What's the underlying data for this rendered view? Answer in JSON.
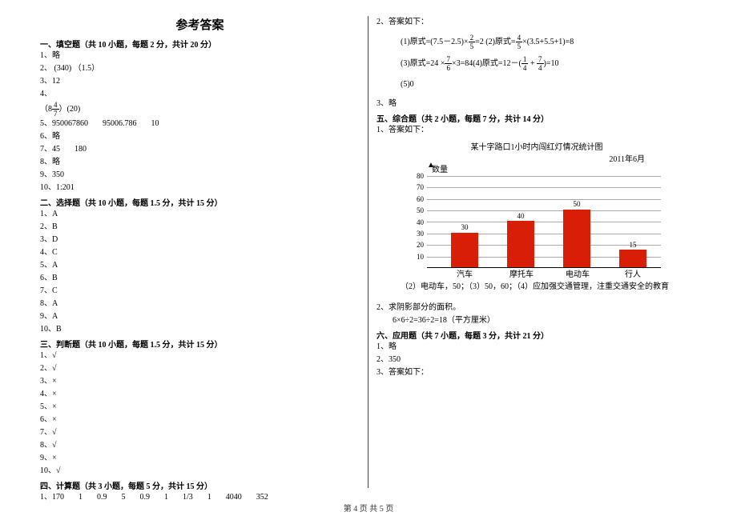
{
  "title": "参考答案",
  "footer": "第 4 页 共 5 页",
  "left": {
    "s1_h": "一、填空题（共 10 小题，每题 2 分，共计 20 分）",
    "s1": {
      "i1": "1、略",
      "i2": "2、 (340) （1.5）",
      "i3": "3、12",
      "i4": "4、",
      "i4_pre": "（8",
      "i4_num": "4",
      "i4_den": "7",
      "i4_post": "）(20)",
      "i5a": "5、950067860",
      "i5b": "95006.786",
      "i5c": "10",
      "i6": "6、略",
      "i7a": "7、45",
      "i7b": "180",
      "i8": "8、略",
      "i9": "9、350",
      "i10": "10、1:201"
    },
    "s2_h": "二、选择题（共 10 小题，每题 1.5 分，共计 15 分）",
    "s2": [
      "1、A",
      "2、B",
      "3、D",
      "4、C",
      "5、A",
      "6、B",
      "7、C",
      "8、A",
      "9、A",
      "10、B"
    ],
    "s3_h": "三、判断题（共 10 小题，每题 1.5 分，共计 15 分）",
    "s3": [
      "1、√",
      "2、√",
      "3、×",
      "4、×",
      "5、×",
      "6、×",
      "7、√",
      "8、√",
      "9、×",
      "10、√"
    ],
    "s4_h": "四、计算题（共 3 小题，每题 5 分，共计 15 分）",
    "s4_row": [
      "1、170",
      "1",
      "0.9",
      "5",
      "0.9",
      "1",
      "1/3",
      "1",
      "4040",
      "352"
    ]
  },
  "right": {
    "r2": "2、答案如下：",
    "eq1_pre": "(1)原式=(7.5－2.5)×",
    "eq1_num": "2",
    "eq1_den": "5",
    "eq1_post1": "=2",
    "eq1_sep": "   (2)原式=",
    "eq2_num": "4",
    "eq2_den": "5",
    "eq2_post": "×(3.5+5.5+1)=8",
    "eq3_pre": "(3)原式=24 ×",
    "eq3_num": "7",
    "eq3_den": "6",
    "eq3_post1": "×3=84",
    "eq4_pre": "(4)原式=12－(",
    "eq4a_num": "1",
    "eq4a_den": "4",
    "eq4_plus": " + ",
    "eq4b_num": "7",
    "eq4b_den": "4",
    "eq4_post": ")=10",
    "eq5": "(5)0",
    "r3": "3、略",
    "s5_h": "五、综合题（共 2 小题，每题 7 分，共计 14 分）",
    "r5_1": "1、答案如下：",
    "chart_title": "某十字路口1小时内闯红灯情况统计图",
    "chart_date": "2011年6月",
    "chart_ylabel": "数量",
    "chart_note1": "（2）电动车，50；（3）50，60；（4）应加强交通管理，注重交通安全的教育",
    "r5_2a": "2、求阴影部分的面积。",
    "r5_2b": "6×6÷2=36÷2=18（平方厘米）",
    "s6_h": "六、应用题（共 7 小题，每题 3 分，共计 21 分）",
    "s6": [
      "1、略",
      "2、350",
      "3、答案如下："
    ]
  },
  "chart_data": {
    "type": "bar",
    "categories": [
      "汽车",
      "摩托车",
      "电动车",
      "行人"
    ],
    "values": [
      30,
      40,
      50,
      15
    ],
    "title": "某十字路口1小时内闯红灯情况统计图",
    "xlabel": "",
    "ylabel": "数量",
    "ylim": [
      0,
      80
    ],
    "yticks": [
      10,
      20,
      30,
      40,
      50,
      60,
      70,
      80
    ],
    "date": "2011年6月"
  }
}
